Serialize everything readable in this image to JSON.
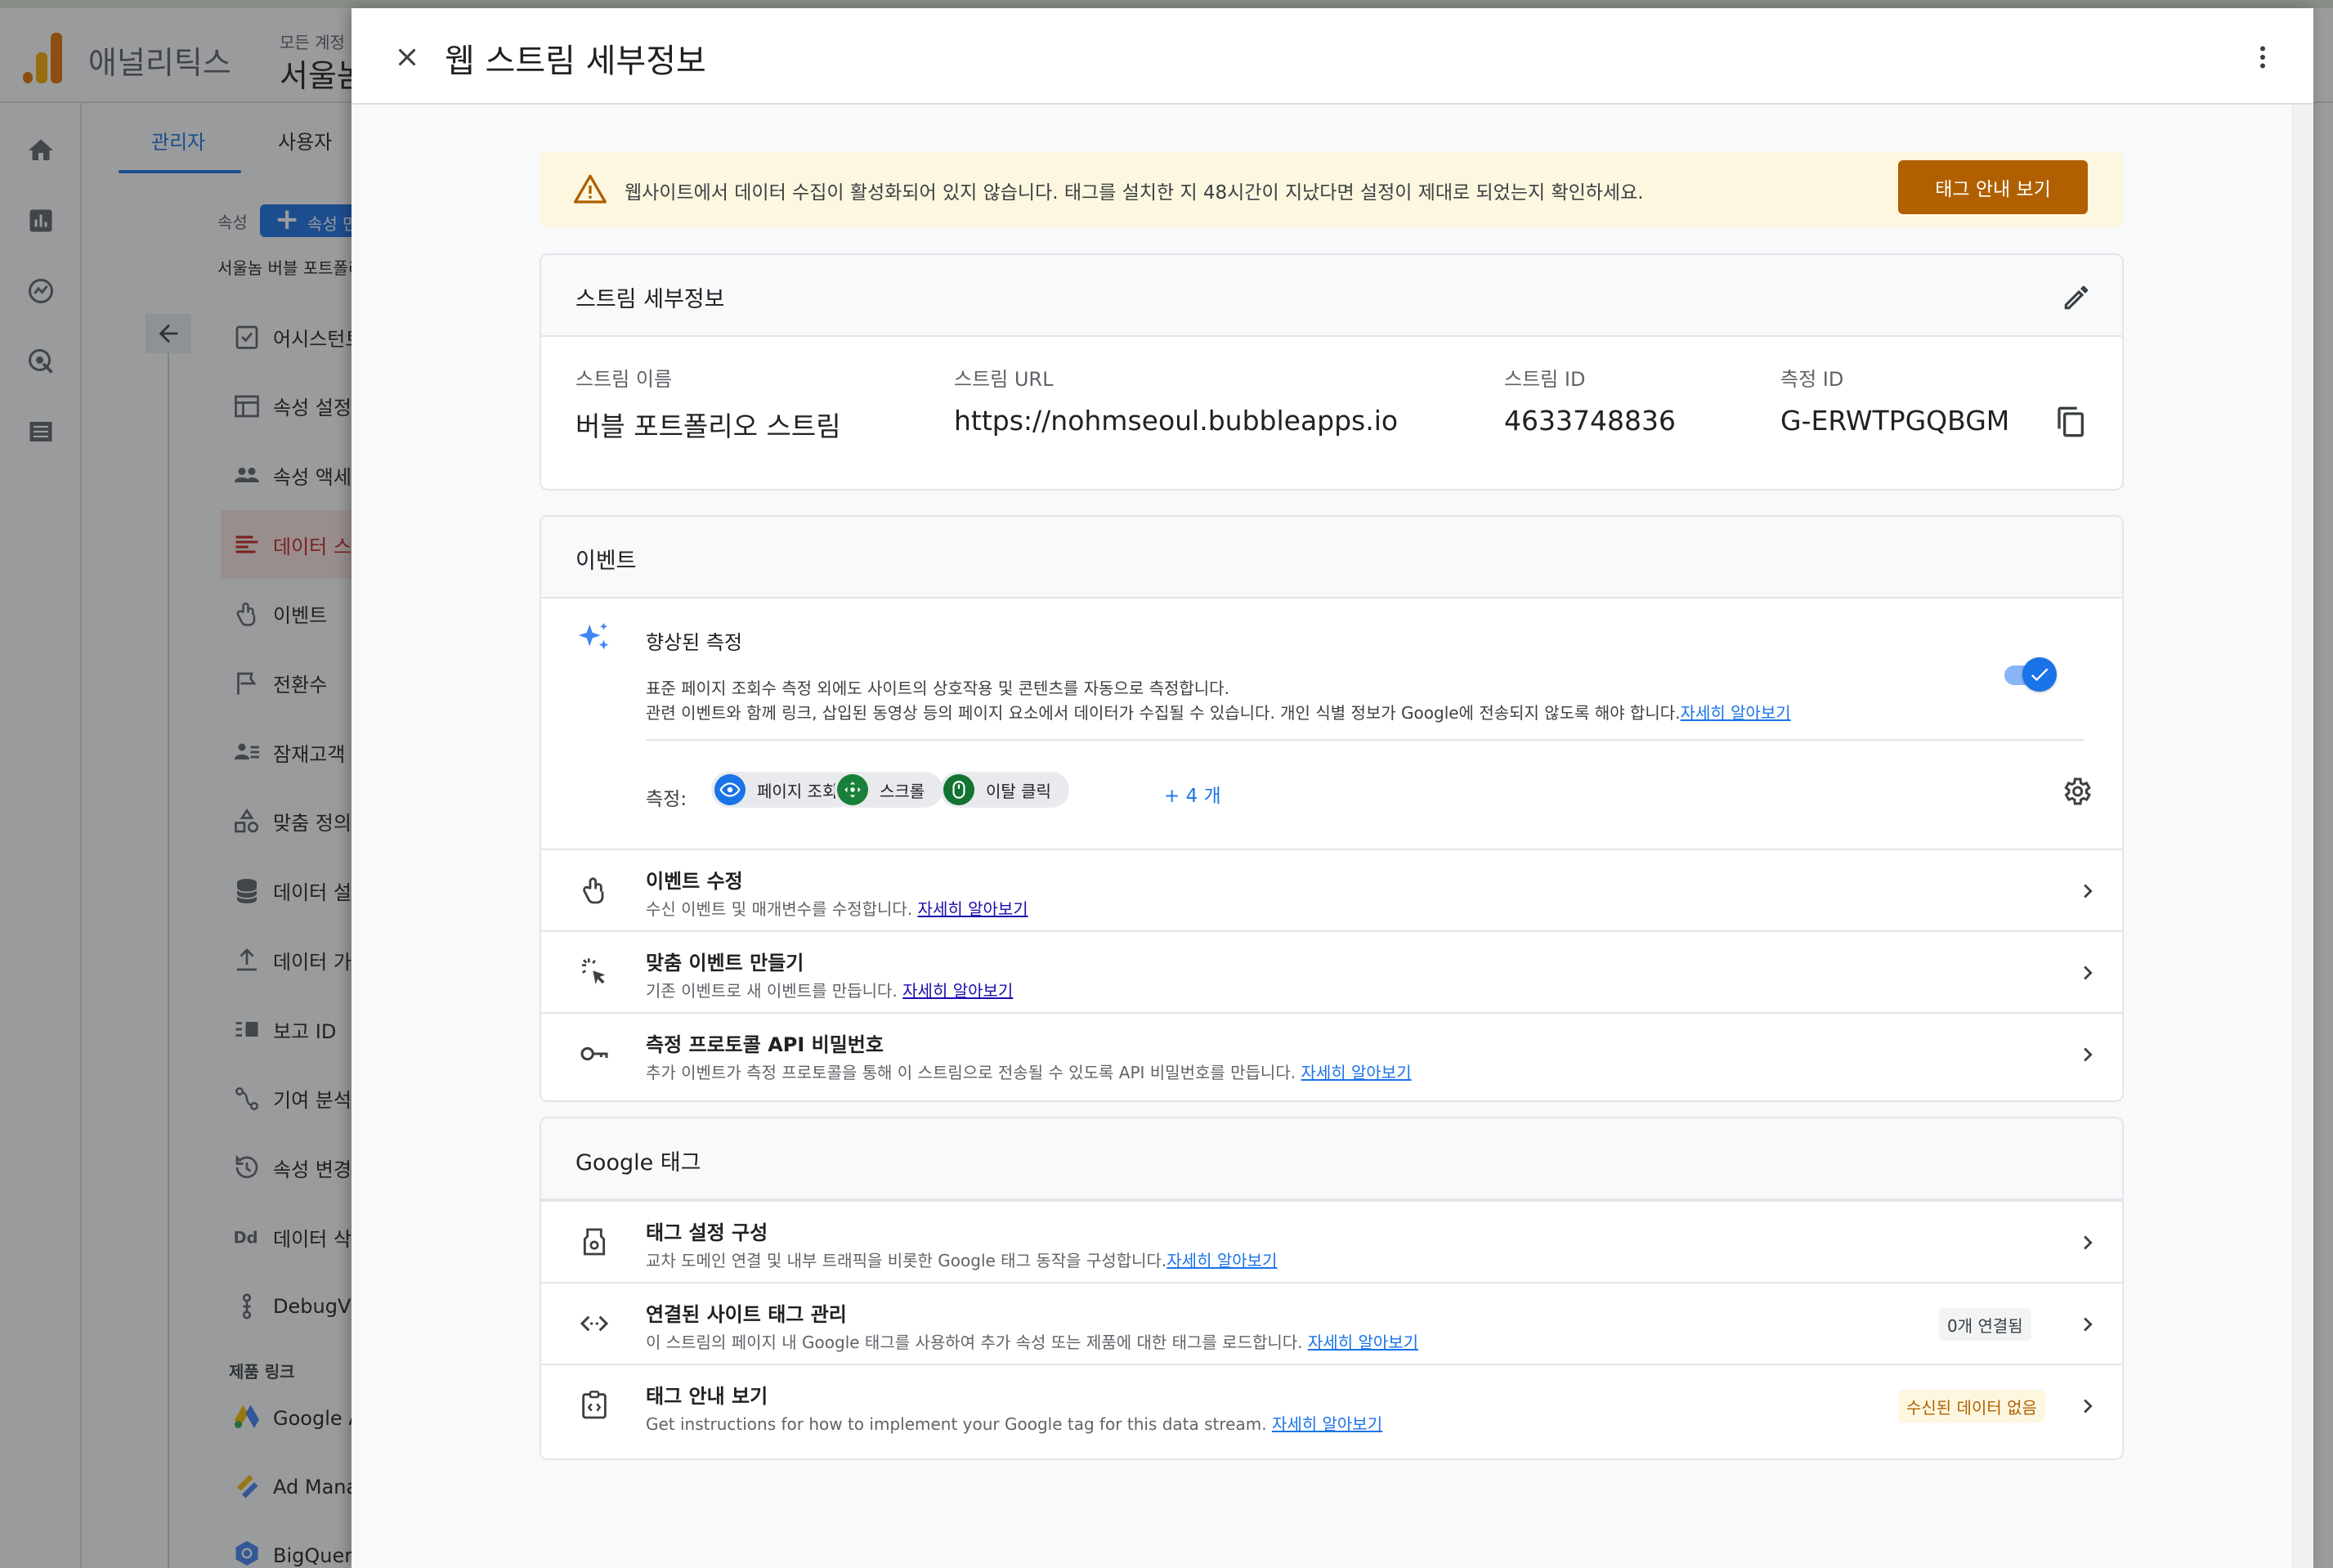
{
  "background": {
    "app_title": "애널리틱스",
    "account_small": "모든 계정",
    "account_big": "서울놈",
    "tabs": {
      "admin": "관리자",
      "user": "사용자"
    },
    "property_label": "속성",
    "property_button": "속성 만들기",
    "property_name": "서울놈 버블 포트폴리오",
    "nav_items": [
      {
        "label": "어시스턴트",
        "icon": "checklist-icon"
      },
      {
        "label": "속성 설정",
        "icon": "property-settings-icon"
      },
      {
        "label": "속성 액세스 관리",
        "icon": "people-icon"
      },
      {
        "label": "데이터 스트림",
        "icon": "data-stream-icon"
      },
      {
        "label": "이벤트",
        "icon": "touch-icon"
      },
      {
        "label": "전환수",
        "icon": "flag-icon"
      },
      {
        "label": "잠재고객",
        "icon": "audience-icon"
      },
      {
        "label": "맞춤 정의",
        "icon": "shapes-icon"
      },
      {
        "label": "데이터 설정",
        "icon": "database-icon"
      },
      {
        "label": "데이터 가져오기",
        "icon": "upload-icon"
      },
      {
        "label": "보고 ID",
        "icon": "reporting-id-icon"
      },
      {
        "label": "기여 분석 설정",
        "icon": "attribution-icon"
      },
      {
        "label": "속성 변경 내역",
        "icon": "history-icon"
      },
      {
        "label": "데이터 삭제 요청",
        "icon": "dd-icon"
      },
      {
        "label": "DebugView",
        "icon": "debug-icon"
      }
    ],
    "product_links_heading": "제품 링크",
    "product_links": [
      {
        "label": "Google Ads 링크"
      },
      {
        "label": "Ad Manager 링크"
      },
      {
        "label": "BigQuery 링크"
      }
    ]
  },
  "panel": {
    "title": "웹 스트림 세부정보",
    "alert": {
      "text": "웹사이트에서 데이터 수집이 활성화되어 있지 않습니다. 태그를 설치한 지 48시간이 지났다면 설정이 제대로 되었는지 확인하세요.",
      "button": "태그 안내 보기"
    },
    "stream_details": {
      "heading": "스트림 세부정보",
      "fields": [
        {
          "label": "스트림 이름",
          "value": "버블 포트폴리오 스트림"
        },
        {
          "label": "스트림 URL",
          "value": "https://nohmseoul.bubbleapps.io"
        },
        {
          "label": "스트림 ID",
          "value": "4633748836"
        },
        {
          "label": "측정 ID",
          "value": "G-ERWTPGQBGM"
        }
      ]
    },
    "events": {
      "heading": "이벤트",
      "enhanced": {
        "title": "향상된 측정",
        "desc1": "표준 페이지 조회수 측정 외에도 사이트의 상호작용 및 콘텐츠를 자동으로 측정합니다.",
        "desc2": "관련 이벤트와 함께 링크, 삽입된 동영상 등의 페이지 요소에서 데이터가 수집될 수 있습니다. 개인 식별 정보가 Google에 전송되지 않도록 해야 합니다.",
        "learn_more": "자세히 알아보기",
        "toggle_on": true,
        "measure_label": "측정:",
        "chips": [
          {
            "label": "페이지 조회",
            "color": "#1a73e8"
          },
          {
            "label": "스크롤",
            "color": "#188038"
          },
          {
            "label": "이탈 클릭",
            "color": "#137333"
          }
        ],
        "more": "+ 4 개"
      },
      "rows": [
        {
          "title": "이벤트 수정",
          "desc": "수신 이벤트 및 매개변수를 수정합니다.",
          "link": "자세히 알아보기"
        },
        {
          "title": "맞춤 이벤트 만들기",
          "desc": "기존 이벤트로 새 이벤트를 만듭니다.",
          "link": "자세히 알아보기"
        },
        {
          "title": "측정 프로토콜 API 비밀번호",
          "desc": "추가 이벤트가 측정 프로토콜을 통해 이 스트림으로 전송될 수 있도록 API 비밀번호를 만듭니다.",
          "link": "자세히 알아보기"
        }
      ]
    },
    "google_tag": {
      "heading": "Google 태그",
      "rows": [
        {
          "title": "태그 설정 구성",
          "desc": "교차 도메인 연결 및 내부 트래픽을 비롯한 Google 태그 동작을 구성합니다.",
          "link": "자세히 알아보기",
          "badge": ""
        },
        {
          "title": "연결된 사이트 태그 관리",
          "desc": "이 스트림의 페이지 내 Google 태그를 사용하여 추가 속성 또는 제품에 대한 태그를 로드합니다.",
          "link": "자세히 알아보기",
          "badge": "0개 연결됨"
        },
        {
          "title": "태그 안내 보기",
          "desc": "Get instructions for how to implement your Google tag for this data stream.",
          "link": "자세히 알아보기",
          "badge": "수신된 데이터 없음"
        }
      ]
    }
  },
  "colors": {
    "accent": "#1a73e8",
    "alert_bg": "#fef7e0",
    "alert_button": "#b06000",
    "warning_badge_bg": "#fef7e0",
    "warning_badge_text": "#b06000",
    "active_nav": "#c5221f"
  }
}
